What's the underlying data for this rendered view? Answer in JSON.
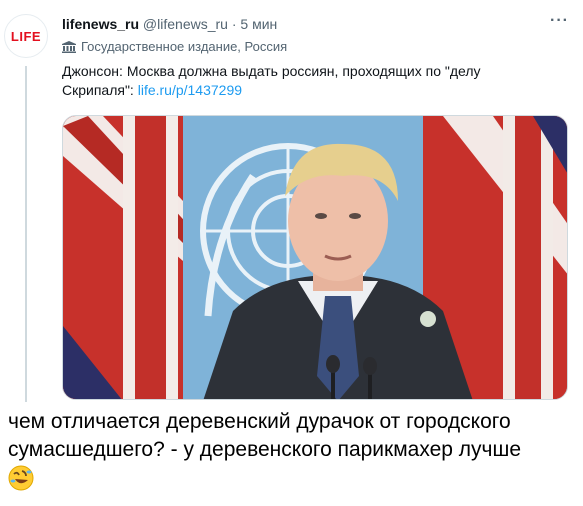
{
  "tweet": {
    "author_name": "lifenews_ru",
    "author_handle": "@lifenews_ru",
    "separator": "·",
    "time": "5 мин",
    "more": "···",
    "avatar_text": "LIFE",
    "label": "Государственное издание, Россия",
    "text": "Джонсон: Москва должна выдать россиян, проходящих по \"делу Скрипаля\": ",
    "link": "life.ru/p/1437299"
  },
  "caption": {
    "line1": "чем отличается деревенский дурачок от городского",
    "line2": "сумасшедшего? - у деревенского парикмахер лучше"
  },
  "colors": {
    "accent": "#1d9bf0",
    "brand": "#e3101f",
    "secondary_text": "#536471"
  },
  "icons": [
    "government-building-icon",
    "more-dots-icon",
    "rolling-laughing-emoji-icon"
  ]
}
